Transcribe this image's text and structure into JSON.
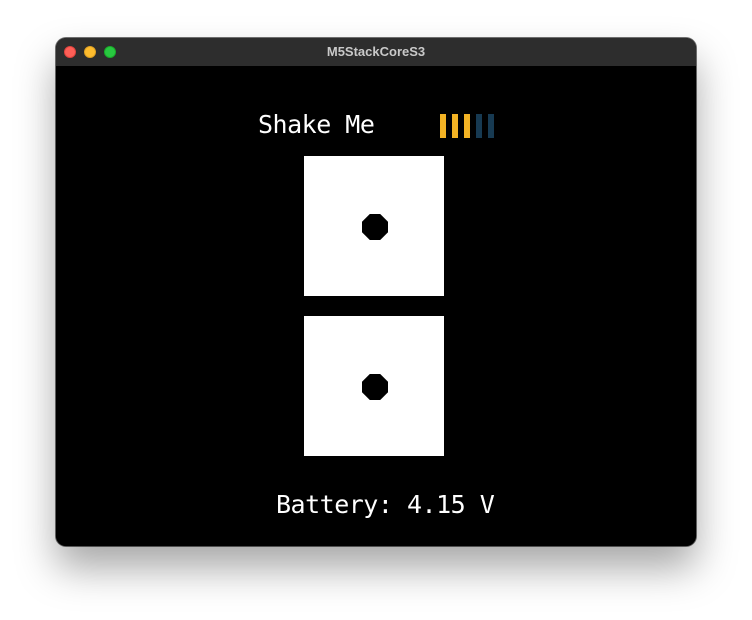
{
  "window": {
    "title": "M5StackCoreS3"
  },
  "screen": {
    "heading": "Shake Me",
    "meter": {
      "total_bars": 5,
      "filled_bars": 3,
      "filled_color": "#f3b324",
      "empty_color": "#173a52"
    },
    "dice": [
      {
        "value": 1
      },
      {
        "value": 1
      }
    ],
    "battery_text": "Battery: 4.15 V"
  }
}
